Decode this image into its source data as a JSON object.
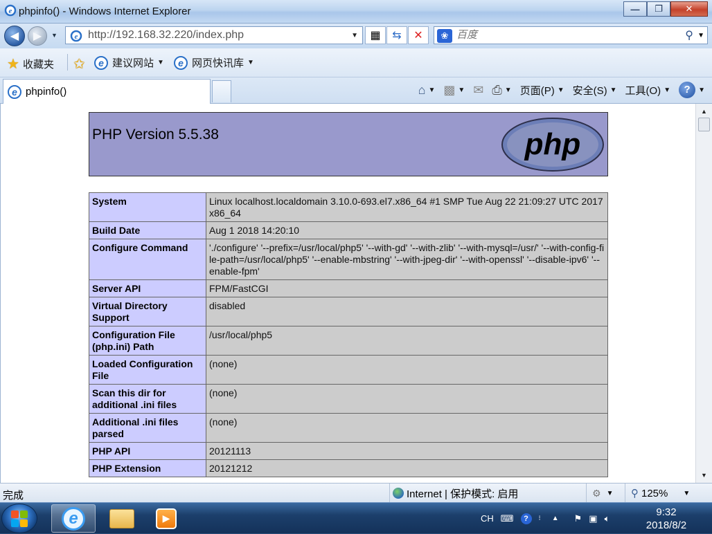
{
  "window": {
    "title": "phpinfo() - Windows Internet Explorer",
    "minimize": "—",
    "maximize": "❐",
    "close": "✕"
  },
  "address_bar": {
    "url": "http://192.168.32.220/index.php",
    "search_placeholder": "百度",
    "search_provider_icon": "baidu-paw-icon"
  },
  "favorites_bar": {
    "favorites_label": "收藏夹",
    "items": [
      {
        "label": "建议网站"
      },
      {
        "label": "网页快讯库"
      }
    ]
  },
  "tabs": [
    {
      "label": "phpinfo()"
    }
  ],
  "command_bar": {
    "page_label": "页面(P)",
    "safety_label": "安全(S)",
    "tools_label": "工具(O)",
    "help_label": "?"
  },
  "phpinfo": {
    "version": "PHP Version 5.5.38",
    "logo_text": "php",
    "rows": [
      {
        "key": "System",
        "value": "Linux localhost.localdomain 3.10.0-693.el7.x86_64 #1 SMP Tue Aug 22 21:09:27 UTC 2017 x86_64"
      },
      {
        "key": "Build Date",
        "value": "Aug 1 2018 14:20:10"
      },
      {
        "key": "Configure Command",
        "value": "'./configure' '--prefix=/usr/local/php5' '--with-gd' '--with-zlib' '--with-mysql=/usr/' '--with-config-file-path=/usr/local/php5' '--enable-mbstring' '--with-jpeg-dir' '--with-openssl' '--disable-ipv6' '--enable-fpm'"
      },
      {
        "key": "Server API",
        "value": "FPM/FastCGI"
      },
      {
        "key": "Virtual Directory Support",
        "value": "disabled"
      },
      {
        "key": "Configuration File (php.ini) Path",
        "value": "/usr/local/php5"
      },
      {
        "key": "Loaded Configuration File",
        "value": "(none)"
      },
      {
        "key": "Scan this dir for additional .ini files",
        "value": "(none)"
      },
      {
        "key": "Additional .ini files parsed",
        "value": "(none)"
      },
      {
        "key": "PHP API",
        "value": "20121113"
      },
      {
        "key": "PHP Extension",
        "value": "20121212"
      }
    ]
  },
  "status_bar": {
    "status": "完成",
    "zone": "Internet | 保护模式: 启用",
    "zoom": "125%"
  },
  "taskbar": {
    "input_method": "CH",
    "time": "9:32",
    "date": "2018/8/2"
  },
  "colors": {
    "php_header_bg": "#9999cc",
    "php_key_bg": "#ccccff",
    "php_value_bg": "#cccccc"
  }
}
